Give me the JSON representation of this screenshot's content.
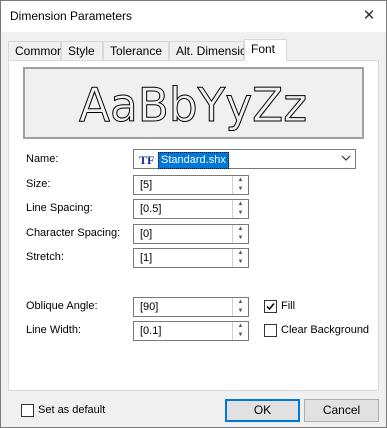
{
  "window": {
    "title": "Dimension Parameters",
    "close_glyph": "✕"
  },
  "tabs": [
    {
      "label": "Common"
    },
    {
      "label": "Style"
    },
    {
      "label": "Tolerance"
    },
    {
      "label": "Alt. Dimension"
    },
    {
      "label": "Font"
    }
  ],
  "preview": {
    "sample_text": "AaBbYyZz"
  },
  "font": {
    "name_label": "Name:",
    "font_type_icon": "TF",
    "font_name": "Standard.shx",
    "size_label": "Size:",
    "size_value": "[5]",
    "line_spacing_label": "Line Spacing:",
    "line_spacing_value": "[0.5]",
    "char_spacing_label": "Character Spacing:",
    "char_spacing_value": "[0]",
    "stretch_label": "Stretch:",
    "stretch_value": "[1]",
    "oblique_label": "Oblique Angle:",
    "oblique_value": "[90]",
    "line_width_label": "Line Width:",
    "line_width_value": "[0.1]",
    "fill_label": "Fill",
    "fill_checked": true,
    "clear_bg_label": "Clear Background",
    "clear_bg_checked": false
  },
  "footer": {
    "set_default_label": "Set as default",
    "set_default_checked": false,
    "ok_label": "OK",
    "cancel_label": "Cancel"
  }
}
